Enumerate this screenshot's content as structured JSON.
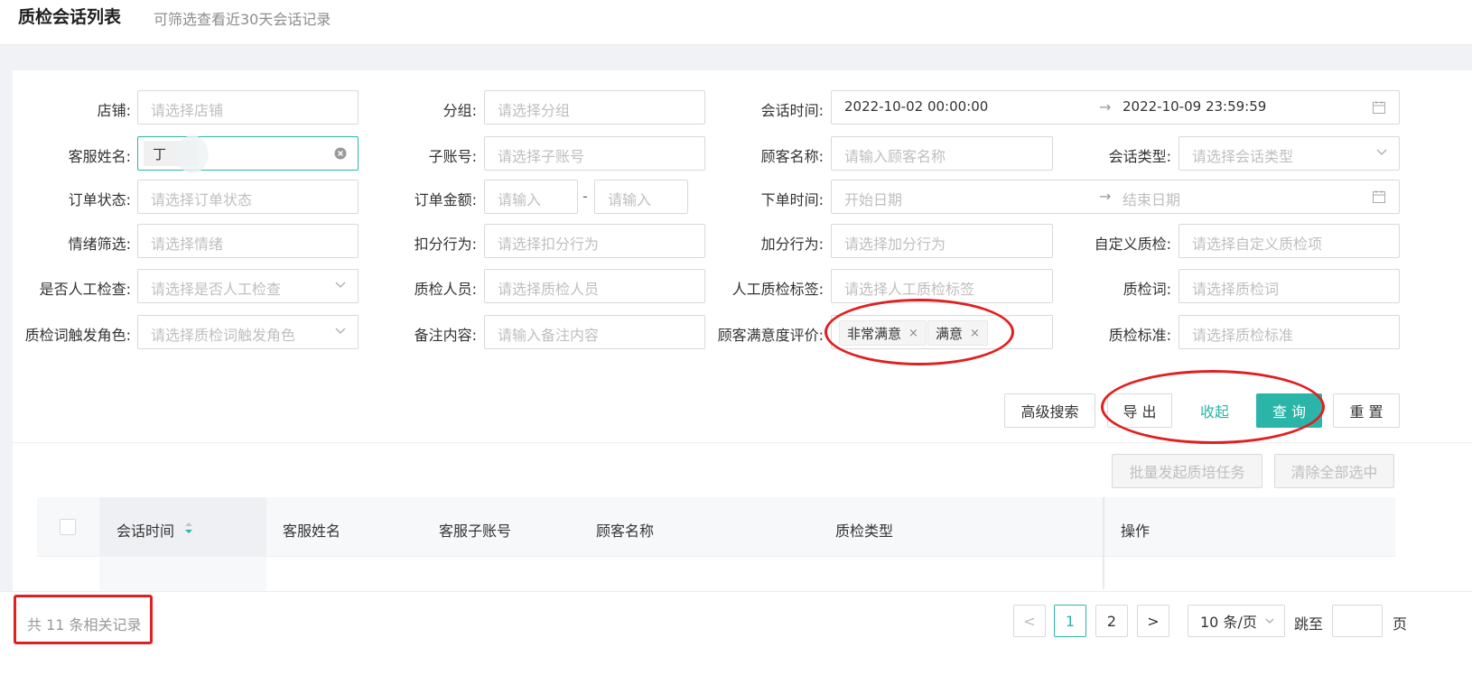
{
  "header": {
    "title": "质检会话列表",
    "subtitle": "可筛选查看近30天会话记录"
  },
  "filters": {
    "shop": {
      "label": "店铺:",
      "placeholder": "请选择店铺"
    },
    "group": {
      "label": "分组:",
      "placeholder": "请选择分组"
    },
    "session_time": {
      "label": "会话时间:",
      "start": "2022-10-02 00:00:00",
      "end": "2022-10-09 23:59:59",
      "separator": "→"
    },
    "agent_name": {
      "label": "客服姓名:",
      "value": "丁"
    },
    "sub_account": {
      "label": "子账号:",
      "placeholder": "请选择子账号"
    },
    "customer_name": {
      "label": "顾客名称:",
      "placeholder": "请输入顾客名称"
    },
    "session_type": {
      "label": "会话类型:",
      "placeholder": "请选择会话类型"
    },
    "order_status": {
      "label": "订单状态:",
      "placeholder": "请选择订单状态"
    },
    "order_amount": {
      "label": "订单金额:",
      "placeholder_min": "请输入",
      "placeholder_max": "请输入",
      "dash": "-"
    },
    "order_time": {
      "label": "下单时间:",
      "start_placeholder": "开始日期",
      "end_placeholder": "结束日期",
      "separator": "→"
    },
    "emotion": {
      "label": "情绪筛选:",
      "placeholder": "请选择情绪"
    },
    "deduct": {
      "label": "扣分行为:",
      "placeholder": "请选择扣分行为"
    },
    "bonus": {
      "label": "加分行为:",
      "placeholder": "请选择加分行为"
    },
    "custom_qc": {
      "label": "自定义质检:",
      "placeholder": "请选择自定义质检项"
    },
    "manual_check": {
      "label": "是否人工检查:",
      "placeholder": "请选择是否人工检查"
    },
    "inspector": {
      "label": "质检人员:",
      "placeholder": "请选择质检人员"
    },
    "manual_tag": {
      "label": "人工质检标签:",
      "placeholder": "请选择人工质检标签"
    },
    "qc_word": {
      "label": "质检词:",
      "placeholder": "请选择质检词"
    },
    "trigger_role": {
      "label": "质检词触发角色:",
      "placeholder": "请选择质检词触发角色"
    },
    "remark": {
      "label": "备注内容:",
      "placeholder": "请输入备注内容"
    },
    "satisfaction": {
      "label": "顾客满意度评价:",
      "tags": [
        "非常满意",
        "满意"
      ],
      "remove": "×"
    },
    "qc_standard": {
      "label": "质检标准:",
      "placeholder": "请选择质检标准"
    }
  },
  "actions": {
    "advanced": "高级搜索",
    "export": "导 出",
    "collapse": "收起",
    "query": "查 询",
    "reset": "重 置"
  },
  "bulk": {
    "start_training": "批量发起质培任务",
    "clear_selection": "清除全部选中"
  },
  "table": {
    "columns": [
      "会话时间",
      "客服姓名",
      "客服子账号",
      "顾客名称",
      "质检类型",
      "操作"
    ]
  },
  "pagination": {
    "total": "共 11 条相关记录",
    "pages": [
      "1",
      "2"
    ],
    "current": "1",
    "page_size": "10 条/页",
    "jump_label": "跳至",
    "page_suffix": "页",
    "prev": "<",
    "next": ">"
  },
  "colors": {
    "primary": "#2bb5a8",
    "annotation": "#e02020"
  }
}
